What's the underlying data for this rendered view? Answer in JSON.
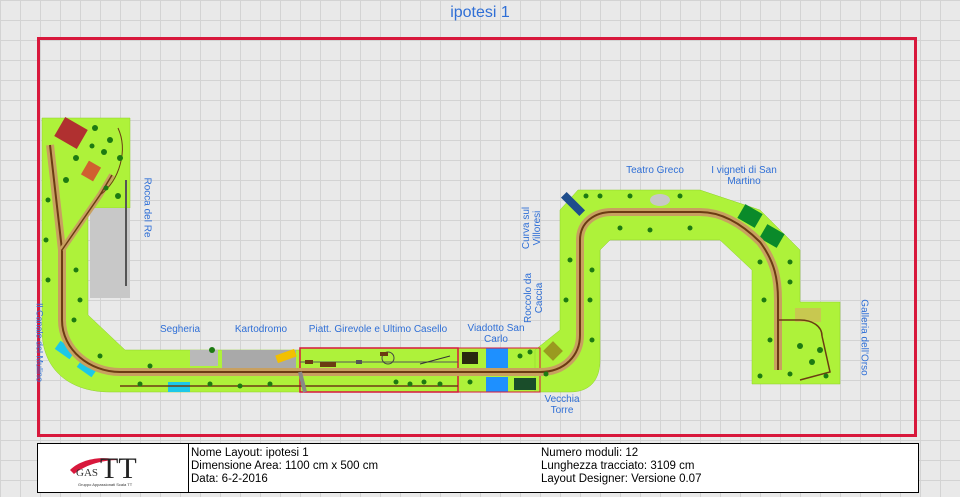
{
  "title": "ipotesi 1",
  "labels": {
    "rocca_del_re": "Rocca del Re",
    "segheria": "Segheria",
    "kartodromo": "Kartodromo",
    "piatt": "Piatt. Girevole e Ultimo Casello",
    "viadotto": "Viadotto San Carlo",
    "cuva_villoresi": "Curva sul Villoresi",
    "roccolo": "Roccolo da Caccia",
    "vecchia_torre": "Vecchia Torre",
    "teatro_greco": "Teatro Greco",
    "vigneti": "I vigneti di San Martino",
    "galleria": "Galleria dell'Orso",
    "left_edge": "Il Canale del Mulino"
  },
  "info": {
    "logo_text": "GAS TT",
    "logo_sub": "Gruppo Appassionati Scala TT",
    "nome": "Nome Layout: ipotesi 1",
    "dimensione": "Dimensione Area: 1100 cm x 500 cm",
    "data": "Data: 6-2-2016",
    "moduli": "Numero moduli: 12",
    "lunghezza": "Lunghezza tracciato: 3109 cm",
    "designer": "Layout Designer: Versione 0.07"
  },
  "colors": {
    "grass": "#aef23a",
    "track_rail": "#6b3c12",
    "track_bed": "#c8a060",
    "frame": "#d8183c",
    "label": "#2f6fd6"
  }
}
